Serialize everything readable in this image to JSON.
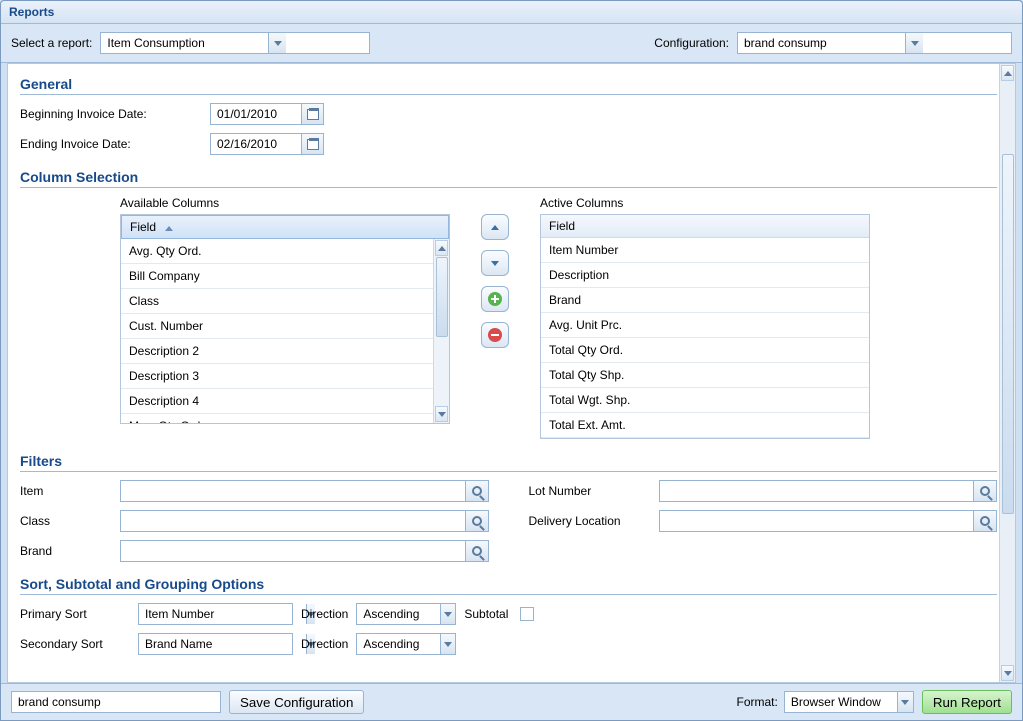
{
  "window_title": "Reports",
  "topbar": {
    "select_label": "Select a report:",
    "report_value": "Item Consumption",
    "config_label": "Configuration:",
    "config_value": "brand consump"
  },
  "general": {
    "section_title": "General",
    "begin_label": "Beginning Invoice Date:",
    "begin_value": "01/01/2010",
    "end_label": "Ending Invoice Date:",
    "end_value": "02/16/2010"
  },
  "columns": {
    "section_title": "Column Selection",
    "available_label": "Available Columns",
    "active_label": "Active Columns",
    "field_header": "Field",
    "available": [
      "Avg. Qty Ord.",
      "Bill Company",
      "Class",
      "Cust. Number",
      "Description 2",
      "Description 3",
      "Description 4",
      "Max. Qty Ord."
    ],
    "active": [
      "Item Number",
      "Description",
      "Brand",
      "Avg. Unit Prc.",
      "Total Qty Ord.",
      "Total Qty Shp.",
      "Total Wgt. Shp.",
      "Total Ext. Amt."
    ]
  },
  "filters": {
    "section_title": "Filters",
    "item_label": "Item",
    "class_label": "Class",
    "brand_label": "Brand",
    "lot_label": "Lot Number",
    "delivery_label": "Delivery Location"
  },
  "sort": {
    "section_title": "Sort, Subtotal and Grouping Options",
    "primary_label": "Primary Sort",
    "secondary_label": "Secondary Sort",
    "direction_label": "Direction",
    "subtotal_label": "Subtotal",
    "primary_field": "Item Number",
    "primary_direction": "Ascending",
    "secondary_field": "Brand Name",
    "secondary_direction": "Ascending"
  },
  "bottom": {
    "config_name_value": "brand consump",
    "save_config_label": "Save Configuration",
    "format_label": "Format:",
    "format_value": "Browser Window",
    "run_label": "Run Report"
  }
}
